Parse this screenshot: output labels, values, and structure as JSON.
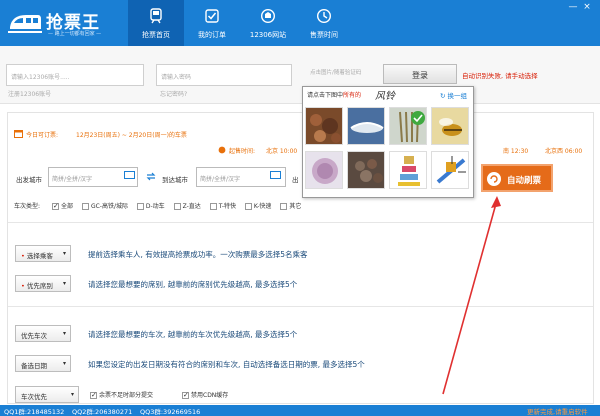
{
  "app": {
    "title": "抢票王",
    "slogan": "— 路上一切都有回家 —"
  },
  "nav": {
    "tabs": [
      {
        "label": "抢票首页"
      },
      {
        "label": "我的订单"
      },
      {
        "label": "12306网站"
      },
      {
        "label": "售票时间"
      }
    ]
  },
  "window": {
    "minimize": "—",
    "close": "×"
  },
  "login": {
    "account_placeholder": "请输入12306账号.....",
    "account_hint": "注册12306账号",
    "password_placeholder": "请输入密码",
    "password_hint": "忘记密码?",
    "captcha_placeholder": "点击图片/随着验证码",
    "login_button": "登录",
    "auto_note": "自动识别失败, 请手动选择"
  },
  "ticket": {
    "today_prefix": "今日可订票:",
    "date_range": "12月23日(周五) ~ 2月20日(周一)的车票",
    "start_time_label": "起售时间:",
    "start_time_value": "北京 10:00",
    "right_times": [
      "南 12:30",
      "北京西 06:00"
    ]
  },
  "form": {
    "from_label": "出发城市",
    "to_label": "到达城市",
    "city_placeholder": "简拼/全拼/汉字",
    "third_label": "出",
    "train_type_label": "车次类型:",
    "train_types": [
      {
        "label": "全部",
        "checked": true
      },
      {
        "label": "GC-高铁/城际",
        "checked": false
      },
      {
        "label": "D-动车",
        "checked": false
      },
      {
        "label": "Z-直达",
        "checked": false
      },
      {
        "label": "T-特快",
        "checked": false
      },
      {
        "label": "K-快速",
        "checked": false
      },
      {
        "label": "其它",
        "checked": false
      }
    ],
    "auto_button": "自动刷票"
  },
  "rows": [
    {
      "button": "选择乘客",
      "text": "提前选择乘车人, 有效提高抢票成功率。一次购票最多选择5名乘客"
    },
    {
      "button": "优先席别",
      "text": "请选择您最想要的席别, 越靠前的席别优先级越高, 最多选择5个"
    },
    {
      "button": "优先车次",
      "text": "请选择您最想要的车次, 越靠前的车次优先级越高, 最多选择5个"
    },
    {
      "button": "备选日期",
      "text": "如果您设定的出发日期没有符合的席别和车次, 自动选择备选日期的票, 最多选择5个"
    }
  ],
  "bottom": {
    "priority_select": "车次优先",
    "opt1": "余票不足时部分提交",
    "opt2": "禁用CDN缓存"
  },
  "captcha": {
    "instruction": "请点击下图中",
    "instruction_strong": "所有的",
    "word": "风铃",
    "refresh": "换一组"
  },
  "footer": {
    "qq1": "QQ1群:218485132",
    "qq2": "QQ2群:206380271",
    "qq3": "QQ3群:392669516",
    "update": "更新完成,请重启软件"
  },
  "colors": {
    "brand": "#1a7fd4",
    "accent": "#e56b19",
    "alert": "#d81e06"
  }
}
